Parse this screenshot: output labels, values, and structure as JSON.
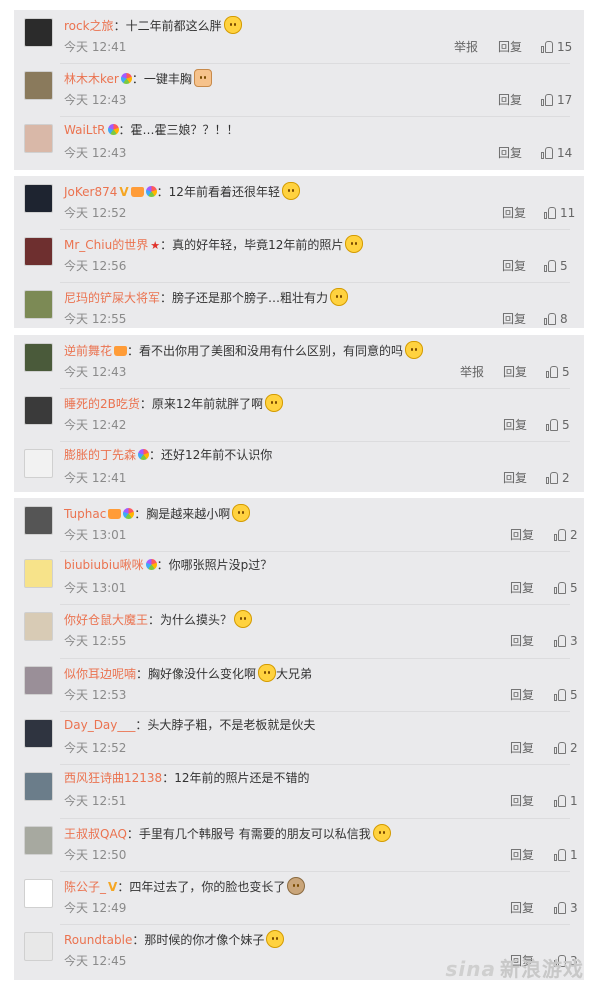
{
  "labels": {
    "report": "举报",
    "reply": "回复"
  },
  "groups": [
    {
      "comments": [
        {
          "user": "rock之旅",
          "badges": [],
          "text": "：十二年前都这么胖",
          "emoji": "cat",
          "time": "今天 12:41",
          "report": true,
          "likes": "15",
          "avatar": "#2b2b2b"
        },
        {
          "user": "林木木ker",
          "badges": [
            "rainbow"
          ],
          "text": "：一键丰胸",
          "emoji": "thumb",
          "time": "今天 12:43",
          "report": false,
          "likes": "17",
          "avatar": "#8a7a5c"
        },
        {
          "user": "WaiLtR",
          "badges": [
            "rainbow"
          ],
          "text": "：霍…霍三娘？？！！",
          "emoji": "",
          "time": "今天 12:43",
          "report": false,
          "likes": "14",
          "avatar": "#d9b8a8"
        }
      ]
    },
    {
      "comments": [
        {
          "user": "JoKer874",
          "badges": [
            "v",
            "crown",
            "rainbow"
          ],
          "text": "：12年前看着还很年轻",
          "emoji": "cat",
          "time": "今天 12:52",
          "report": false,
          "likes": "11",
          "avatar": "#1e2430"
        },
        {
          "user": "Mr_Chiu的世界",
          "badges": [
            "star"
          ],
          "text": "：真的好年轻，毕竟12年前的照片",
          "emoji": "cat",
          "time": "今天 12:56",
          "report": false,
          "likes": "5",
          "avatar": "#6e2f2f"
        },
        {
          "user": "尼玛的铲屎大将军",
          "badges": [],
          "text": "：膀子还是那个膀子…粗壮有力",
          "emoji": "cat",
          "time": "今天 12:55",
          "report": false,
          "likes": "8",
          "avatar": "#7c8a55"
        }
      ]
    },
    {
      "comments": [
        {
          "user": "逆前舞花",
          "badges": [
            "crown"
          ],
          "text": "：看不出你用了美图和没用有什么区别，有同意的吗",
          "emoji": "cat",
          "time": "今天 12:43",
          "report": true,
          "likes": "5",
          "avatar": "#4a5a3a"
        },
        {
          "user": "睡死的2B吃货",
          "badges": [],
          "text": "：原来12年前就胖了啊",
          "emoji": "cat",
          "time": "今天 12:42",
          "report": false,
          "likes": "5",
          "avatar": "#3a3a3a"
        },
        {
          "user": "膨胀的丁先森",
          "badges": [
            "rainbow"
          ],
          "text": "：还好12年前不认识你",
          "emoji": "",
          "time": "今天 12:41",
          "report": false,
          "likes": "2",
          "avatar": "#f2f2f2"
        }
      ]
    },
    {
      "comments": [
        {
          "user": "Tuphac",
          "badges": [
            "crown",
            "rainbow"
          ],
          "text": "：胸是越来越小啊",
          "emoji": "cat",
          "time": "今天 13:01",
          "report": false,
          "likes": "2",
          "avatar": "#555555"
        },
        {
          "user": "biubiubiu啾咪",
          "badges": [
            "rainbow"
          ],
          "text": "：你哪张照片没p过？",
          "emoji": "",
          "time": "今天 13:01",
          "report": false,
          "likes": "5",
          "avatar": "#f7e38a"
        },
        {
          "user": "你好仓鼠大魔王",
          "badges": [],
          "text": "：为什么摸头？",
          "emoji": "face",
          "time": "今天 12:55",
          "report": false,
          "likes": "3",
          "avatar": "#d8cbb5"
        },
        {
          "user": "似你耳边呢喃",
          "badges": [],
          "text": "：胸好像没什么变化啊",
          "emoji": "cat",
          "after": "大兄弟",
          "time": "今天 12:53",
          "report": false,
          "likes": "5",
          "avatar": "#9a8f98"
        },
        {
          "user": "Day_Day___",
          "badges": [],
          "text": "：头大脖子粗，不是老板就是伙夫",
          "emoji": "",
          "time": "今天 12:52",
          "report": false,
          "likes": "2",
          "avatar": "#2f3440"
        },
        {
          "user": "西风狂诗曲12138",
          "badges": [],
          "text": "：12年前的照片还是不错的",
          "emoji": "",
          "time": "今天 12:51",
          "report": false,
          "likes": "1",
          "avatar": "#6b7d8a"
        },
        {
          "user": "王叔叔QAQ",
          "badges": [],
          "text": "：手里有几个韩服号 有需要的朋友可以私信我",
          "emoji": "face",
          "time": "今天 12:50",
          "report": false,
          "likes": "1",
          "avatar": "#a7a9a0"
        },
        {
          "user": "陈公子_",
          "badges": [
            "v"
          ],
          "text": "：四年过去了，你的脸也变长了",
          "emoji": "dog",
          "time": "今天 12:49",
          "report": false,
          "likes": "3",
          "avatar": "#ffffff"
        },
        {
          "user": "Roundtable",
          "badges": [],
          "text": "：那时候的你才像个妹子",
          "emoji": "face",
          "time": "今天 12:45",
          "report": false,
          "likes": "3",
          "avatar": "#e8e8e8"
        }
      ]
    }
  ],
  "watermark": {
    "brand": "sina",
    "text": "新浪游戏"
  }
}
